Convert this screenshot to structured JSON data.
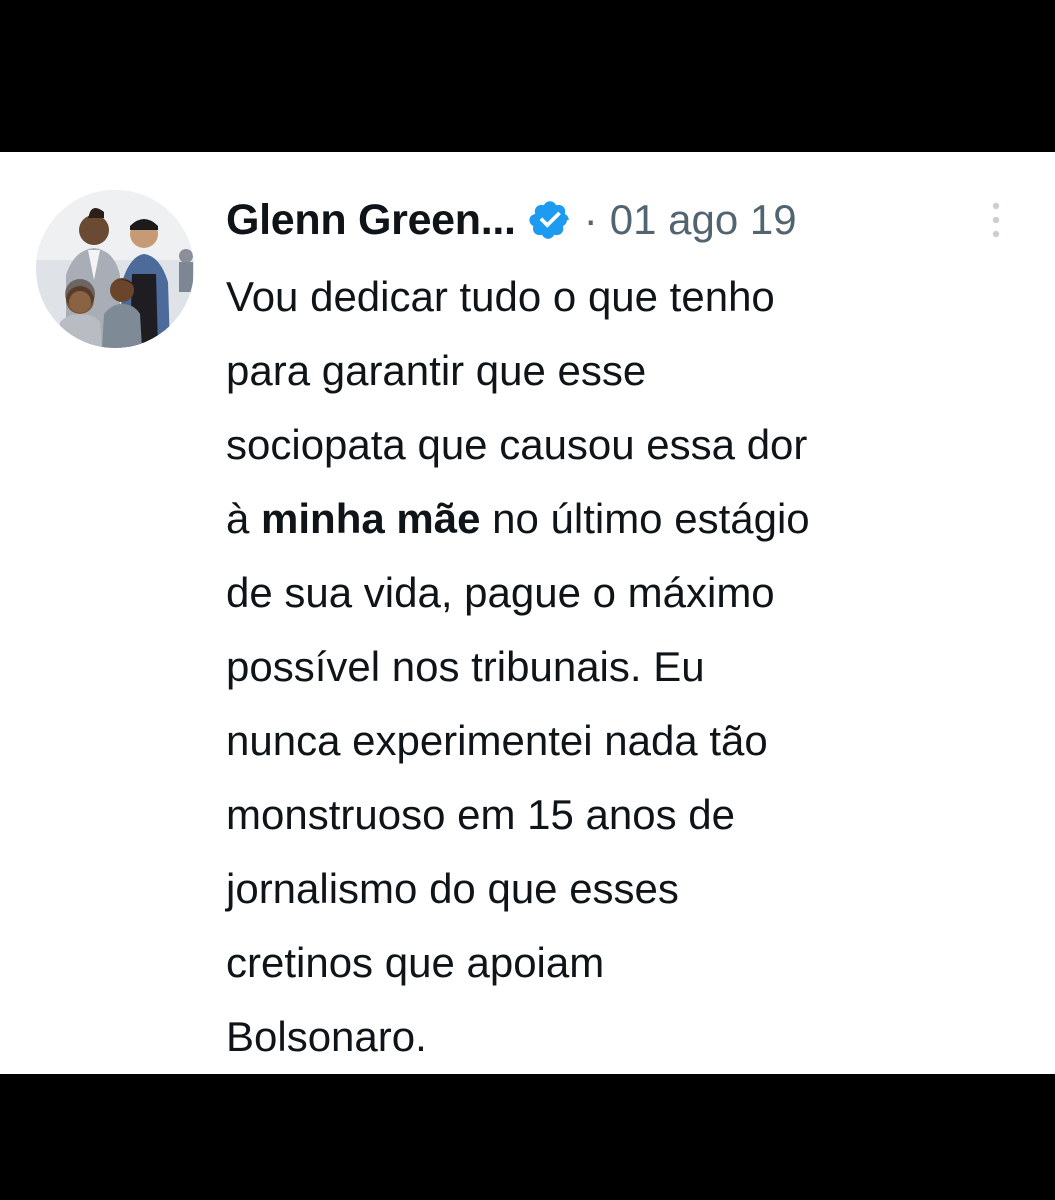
{
  "tweet": {
    "author_name": "Glenn Green...",
    "separator": "·",
    "timestamp": "01 ago 19",
    "verified": true,
    "avatar": "family-photo-avatar",
    "more_icon": "vertical-dots-icon",
    "text_lines": [
      {
        "pre": "Vou dedicar tudo o que tenho"
      },
      {
        "pre": "para garantir que esse"
      },
      {
        "pre": "sociopata que causou essa dor"
      },
      {
        "pre": "à ",
        "bold": "minha mãe",
        "post": " no último estágio"
      },
      {
        "pre": "de sua vida, pague o máximo"
      },
      {
        "pre": "possível nos tribunais. Eu"
      },
      {
        "pre": "nunca experimentei nada tão"
      },
      {
        "pre": "monstruoso em 15 anos de"
      },
      {
        "pre": "jornalismo do que esses"
      },
      {
        "pre": "cretinos que apoiam"
      },
      {
        "pre": "Bolsonaro."
      }
    ]
  },
  "colors": {
    "background": "#ffffff",
    "letterbox": "#000000",
    "text": "#0f1419",
    "secondary_text": "#536471",
    "verified_badge": "#1d9bf0"
  }
}
